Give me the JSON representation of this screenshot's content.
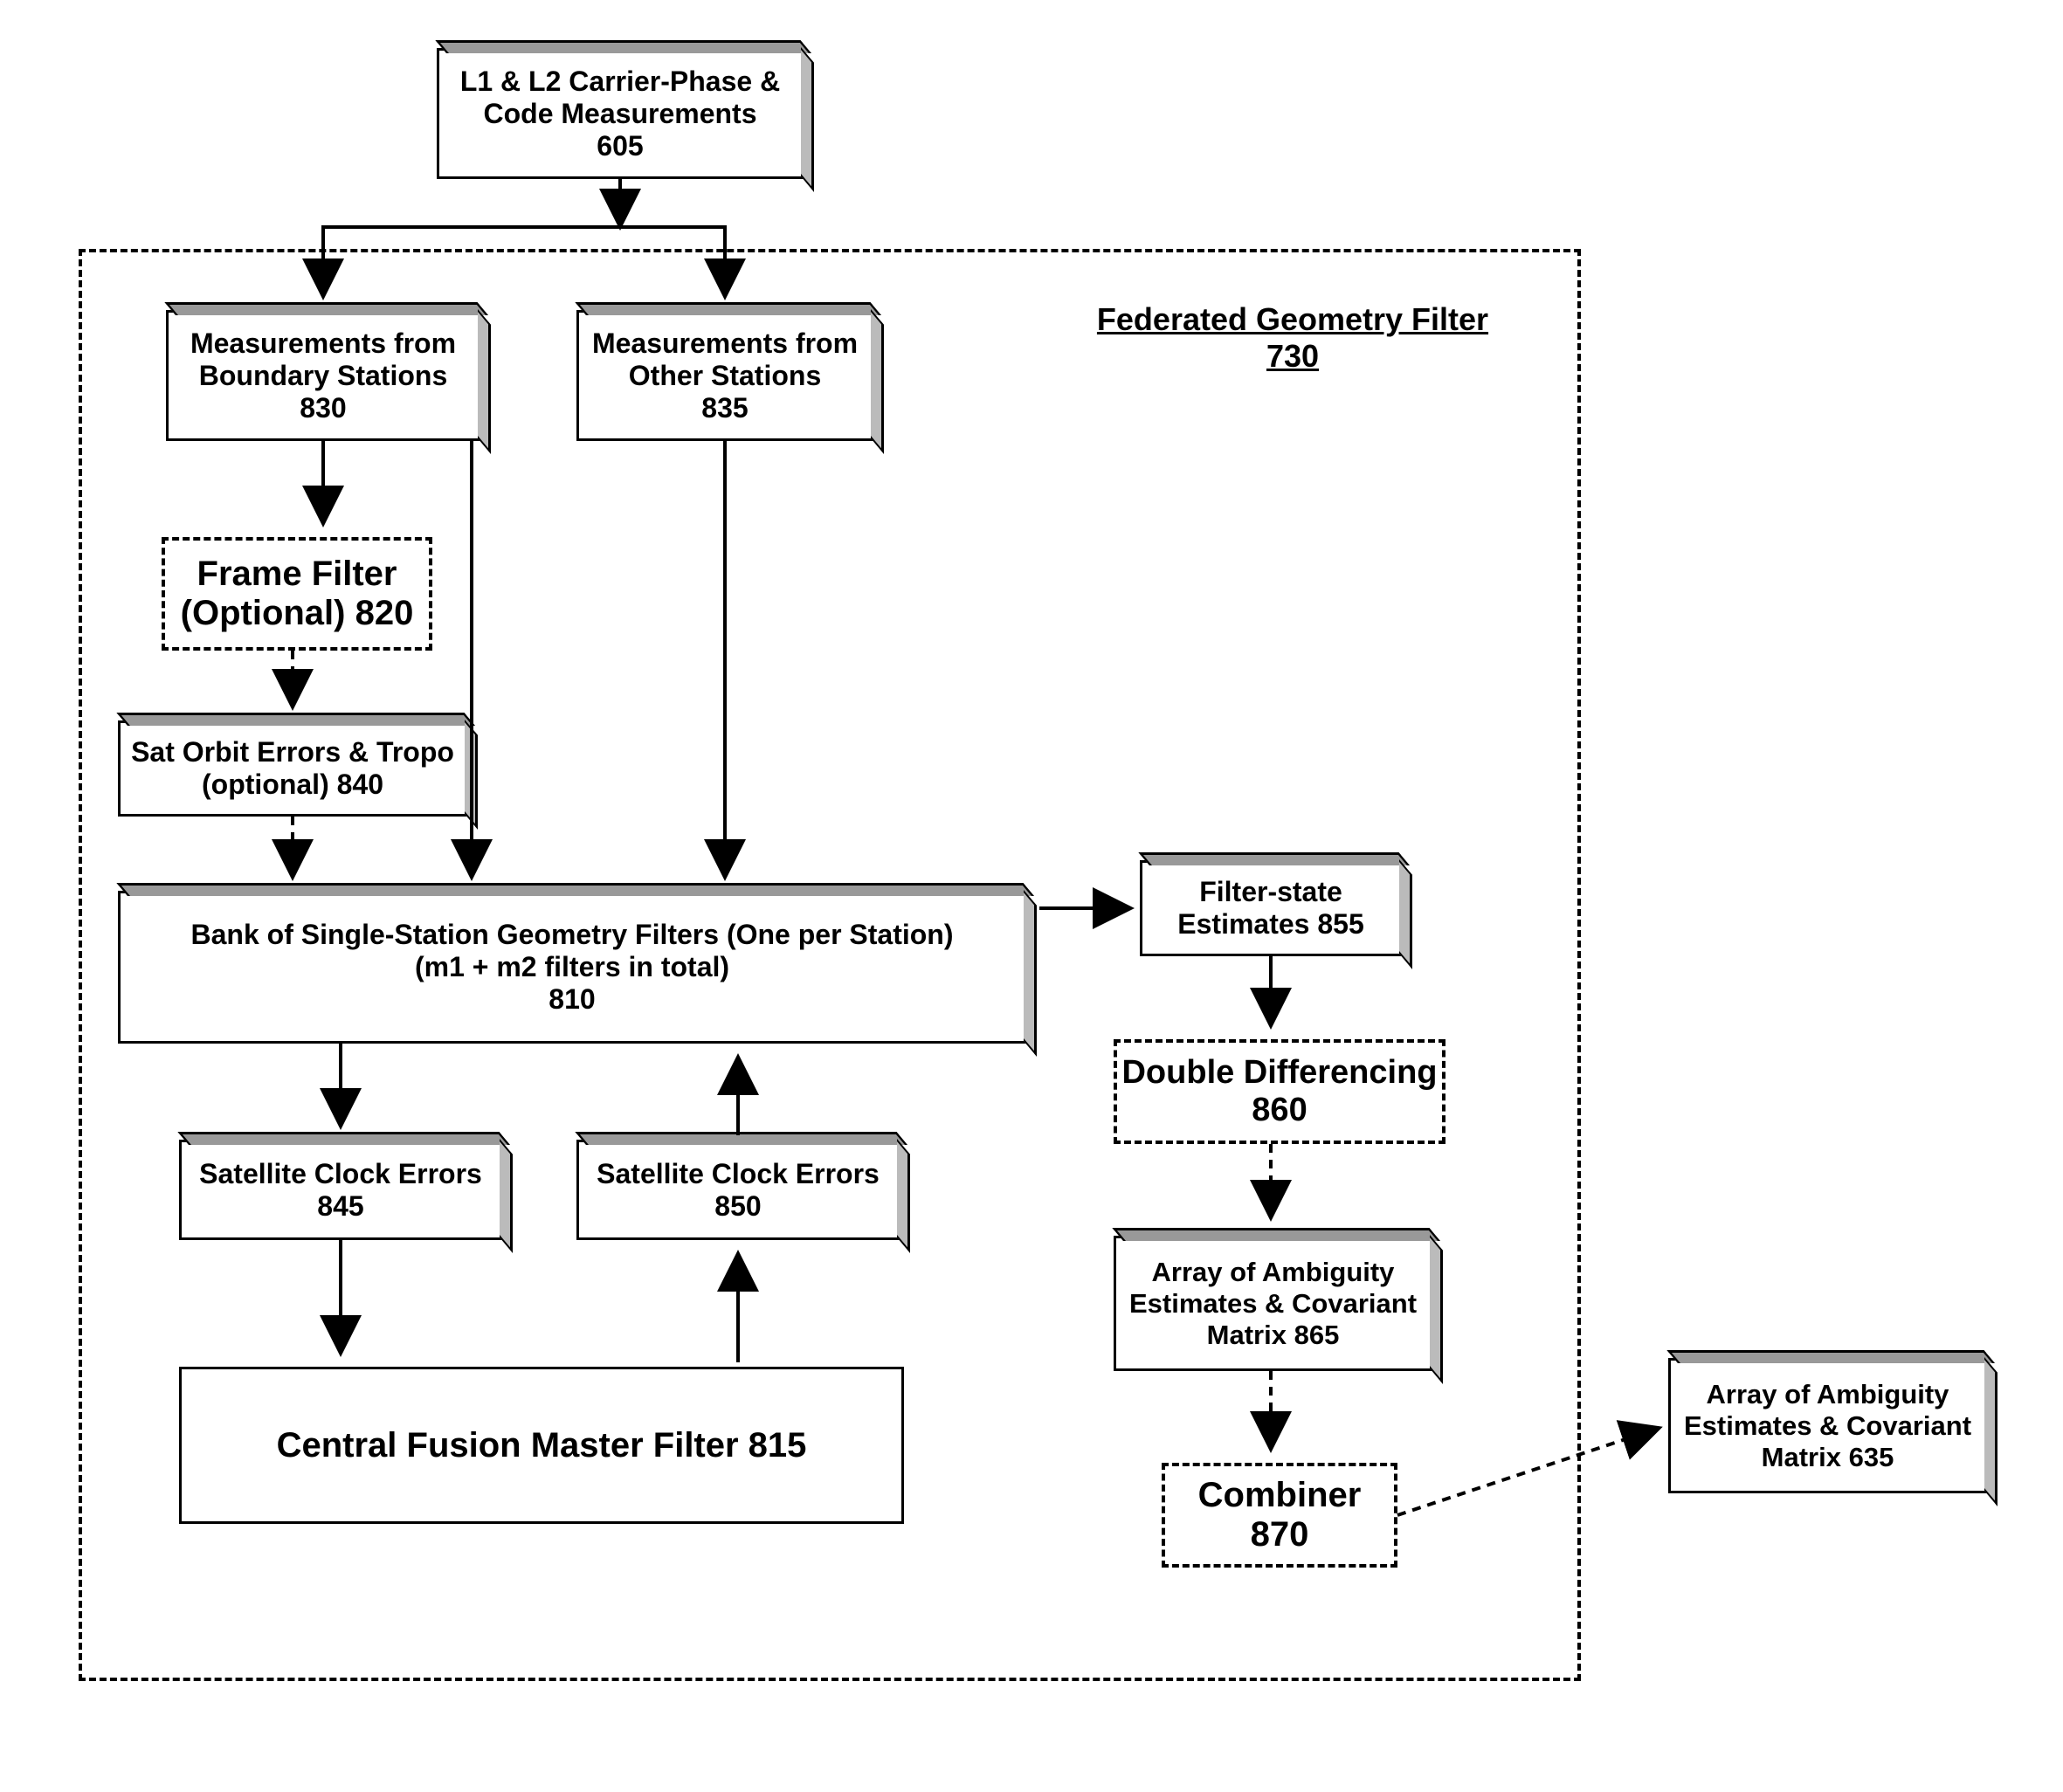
{
  "nodes": {
    "n605": {
      "l1": "L1 & L2 Carrier-Phase &",
      "l2": "Code Measurements",
      "id": "605"
    },
    "n830": {
      "l1": "Measurements from",
      "l2": "Boundary Stations",
      "id": "830"
    },
    "n835": {
      "l1": "Measurements from",
      "l2": "Other Stations",
      "id": "835"
    },
    "n820": {
      "l1": "Frame Filter",
      "l2": "(Optional) 820"
    },
    "n840": {
      "l1": "Sat Orbit Errors & Tropo",
      "l2": "(optional) 840"
    },
    "n810": {
      "l1": "Bank of Single-Station Geometry Filters (One per Station)",
      "l2": "(m1 + m2 filters in total)",
      "id": "810"
    },
    "n845": {
      "l1": "Satellite Clock Errors",
      "id": "845"
    },
    "n850": {
      "l1": "Satellite Clock Errors",
      "id": "850"
    },
    "n815": {
      "l1": "Central Fusion Master Filter 815"
    },
    "n855": {
      "l1": "Filter-state",
      "l2": "Estimates 855"
    },
    "n860": {
      "l1": "Double Differencing",
      "id": "860"
    },
    "n865": {
      "l1": "Array of Ambiguity",
      "l2": "Estimates & Covariant",
      "l3": "Matrix 865"
    },
    "n870": {
      "l1": "Combiner",
      "id": "870"
    },
    "n635": {
      "l1": "Array of Ambiguity",
      "l2": "Estimates & Covariant",
      "l3": "Matrix 635"
    },
    "title": {
      "t": "Federated Geometry Filter",
      "id": "730"
    }
  }
}
